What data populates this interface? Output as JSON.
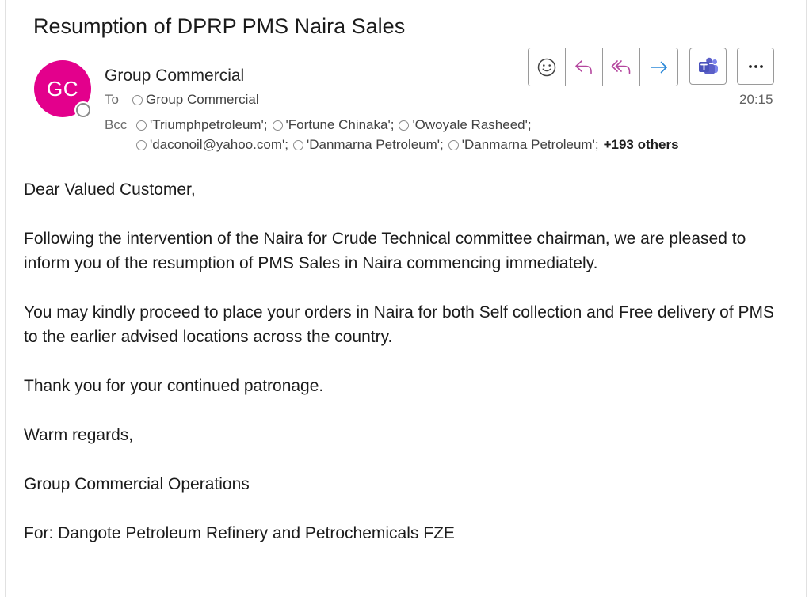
{
  "email": {
    "subject": "Resumption of DPRP PMS Naira Sales",
    "avatar_initials": "GC",
    "avatar_color": "#e3008c",
    "sender": "Group Commercial",
    "to_label": "To",
    "to": [
      "Group Commercial"
    ],
    "time": "20:15",
    "bcc_label": "Bcc",
    "bcc_row1": [
      "'Triumphpetroleum';",
      "'Fortune Chinaka';",
      "'Owoyale Rasheed';"
    ],
    "bcc_row2": [
      "'daconoil@yahoo.com';",
      "'Danmarna Petroleum';",
      "'Danmarna Petroleum';"
    ],
    "bcc_others": "+193 others"
  },
  "toolbar": {
    "icons": [
      "smiley-icon",
      "reply-icon",
      "reply-all-icon",
      "forward-icon",
      "teams-icon",
      "more-icon"
    ],
    "accent_purple": "#b4469e",
    "accent_blue": "#2b88d8",
    "teams_color": "#5b5fc7"
  },
  "body": {
    "greeting": "Dear Valued Customer,",
    "p1": "Following the intervention of the Naira for Crude Technical committee chairman, we are pleased to inform you of the resumption of PMS Sales in Naira commencing immediately.",
    "p2": "You may kindly proceed to place your orders in Naira for both Self collection and Free delivery of PMS to the earlier advised locations across the country.",
    "p3": "Thank you for your continued patronage.",
    "closing": "Warm regards,",
    "sig_line1": "Group Commercial Operations",
    "sig_line2": "For: Dangote Petroleum Refinery and Petrochemicals FZE"
  }
}
